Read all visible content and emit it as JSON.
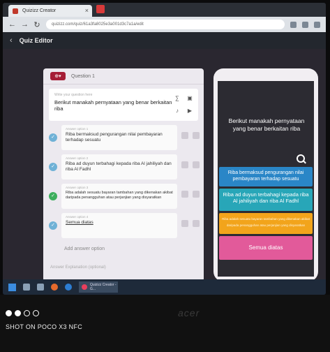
{
  "browser": {
    "tab_title": "Quizizz Creator",
    "tab_close": "×",
    "url": "quizizz.com/quiz/61a3fa8025e3a001d3c7a1a/edit"
  },
  "app": {
    "back": "‹",
    "title": "Quiz Editor"
  },
  "editor": {
    "question_label": "Question 1",
    "question_placeholder": "Write your question here",
    "question_text": "Berikut manakah pernyataan yang benar berkaitan riba",
    "tools": [
      "Math",
      "Image",
      "Audio",
      "Video"
    ],
    "answers": [
      {
        "label": "Answer option 1",
        "text": "Riba bermaksud pengurangan nilai pembayaran terhadap sesuatu",
        "correct": false
      },
      {
        "label": "Answer option 2",
        "text": "Riba ad duyun terbahagi kepada riba Al jahiliyah dan riba Al Fadhl",
        "correct": false
      },
      {
        "label": "Answer option 3",
        "text": "Riba adalah sesuatu bayaran tambahan yang dikenakan akibat daripada penangguhan atau perjanjian yang disyaratkan",
        "correct": true
      },
      {
        "label": "Answer option 4",
        "text": "Semua diatas",
        "correct": false
      }
    ],
    "add_answer": "Add answer option",
    "add_explanation": "Answer Explanation (optional)"
  },
  "preview": {
    "question": "Berikut manakah pernyataan yang benar berkaitan riba",
    "options": [
      "Riba bermaksud pengurangan nilai pembayaran terhadap sesuatu",
      "Riba ad duyun terbahagi kepada riba Al jahiliyah dan riba Al Fadhl",
      "Riba adalah sesuatu bayaran tambahan yang dikenakan akibat daripada penangguhan atau perjanjian yang disyaratkan",
      "Semua diatas"
    ]
  },
  "taskbar": {
    "app_label": "Quizizz Creator - G..."
  },
  "overlay": {
    "brand": "acer",
    "watermark": "SHOT ON POCO X3 NFC"
  },
  "colors": {
    "correct": "#3cae5c",
    "option_blue": "#2a86c7",
    "option_teal": "#28a6b8",
    "option_orange": "#f2a41b",
    "option_pink": "#e25a9a"
  }
}
